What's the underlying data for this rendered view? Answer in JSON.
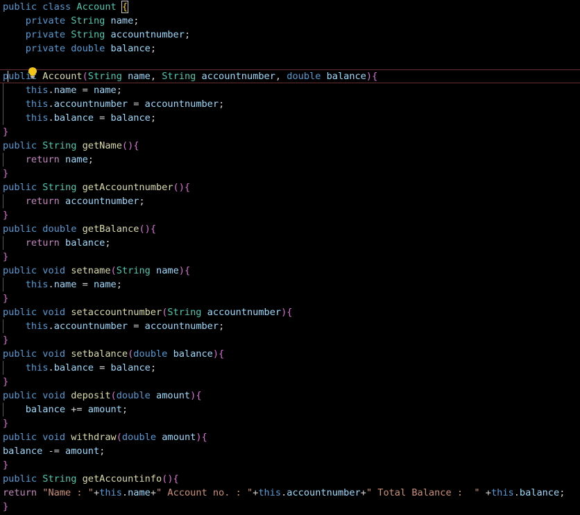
{
  "colors": {
    "background": "#000000",
    "keyword": "#569cd6",
    "type": "#4ec9b0",
    "method": "#dcdcaa",
    "variable": "#9cdcfe",
    "plain": "#d4d4d4",
    "string": "#ce9178",
    "control": "#c586c0",
    "bracket_gold": "#ffd700",
    "bracket_purple": "#da70d6",
    "bracket_blue": "#179fff"
  },
  "editor": {
    "icons": {
      "lightbulb": "lightbulb-icon"
    },
    "lines": [
      [
        [
          "public",
          "keyword"
        ],
        [
          " ",
          "plain"
        ],
        [
          "class",
          "keyword"
        ],
        [
          " ",
          "plain"
        ],
        [
          "Account",
          "type"
        ],
        [
          " ",
          "plain"
        ],
        [
          "{",
          "bracket_gold"
        ]
      ],
      [
        [
          "    ",
          "plain"
        ],
        [
          "private",
          "keyword"
        ],
        [
          " ",
          "plain"
        ],
        [
          "String",
          "type"
        ],
        [
          " ",
          "plain"
        ],
        [
          "name",
          "variable"
        ],
        [
          ";",
          "plain"
        ]
      ],
      [
        [
          "    ",
          "plain"
        ],
        [
          "private",
          "keyword"
        ],
        [
          " ",
          "plain"
        ],
        [
          "String",
          "type"
        ],
        [
          " ",
          "plain"
        ],
        [
          "accountnumber",
          "variable"
        ],
        [
          ";",
          "plain"
        ]
      ],
      [
        [
          "    ",
          "plain"
        ],
        [
          "private",
          "keyword"
        ],
        [
          " ",
          "plain"
        ],
        [
          "double",
          "keyword"
        ],
        [
          " ",
          "plain"
        ],
        [
          "balance",
          "variable"
        ],
        [
          ";",
          "plain"
        ]
      ],
      [],
      [
        [
          "public",
          "keyword"
        ],
        [
          " ",
          "plain"
        ],
        [
          "Account",
          "method"
        ],
        [
          "(",
          "bracket_purple"
        ],
        [
          "String",
          "type"
        ],
        [
          " ",
          "plain"
        ],
        [
          "name",
          "variable"
        ],
        [
          ", ",
          "plain"
        ],
        [
          "String",
          "type"
        ],
        [
          " ",
          "plain"
        ],
        [
          "accountnumber",
          "variable"
        ],
        [
          ", ",
          "plain"
        ],
        [
          "double",
          "keyword"
        ],
        [
          " ",
          "plain"
        ],
        [
          "balance",
          "variable"
        ],
        [
          ")",
          "bracket_purple"
        ],
        [
          "{",
          "bracket_purple"
        ]
      ],
      [
        [
          "    ",
          "plain"
        ],
        [
          "this",
          "keyword"
        ],
        [
          ".",
          "plain"
        ],
        [
          "name",
          "variable"
        ],
        [
          " = ",
          "plain"
        ],
        [
          "name",
          "variable"
        ],
        [
          ";",
          "plain"
        ]
      ],
      [
        [
          "    ",
          "plain"
        ],
        [
          "this",
          "keyword"
        ],
        [
          ".",
          "plain"
        ],
        [
          "accountnumber",
          "variable"
        ],
        [
          " = ",
          "plain"
        ],
        [
          "accountnumber",
          "variable"
        ],
        [
          ";",
          "plain"
        ]
      ],
      [
        [
          "    ",
          "plain"
        ],
        [
          "this",
          "keyword"
        ],
        [
          ".",
          "plain"
        ],
        [
          "balance",
          "variable"
        ],
        [
          " = ",
          "plain"
        ],
        [
          "balance",
          "variable"
        ],
        [
          ";",
          "plain"
        ]
      ],
      [
        [
          "}",
          "bracket_purple"
        ]
      ],
      [
        [
          "public",
          "keyword"
        ],
        [
          " ",
          "plain"
        ],
        [
          "String",
          "type"
        ],
        [
          " ",
          "plain"
        ],
        [
          "getName",
          "method"
        ],
        [
          "()",
          "bracket_purple"
        ],
        [
          "{",
          "bracket_purple"
        ]
      ],
      [
        [
          "    ",
          "plain"
        ],
        [
          "return",
          "control"
        ],
        [
          " ",
          "plain"
        ],
        [
          "name",
          "variable"
        ],
        [
          ";",
          "plain"
        ]
      ],
      [
        [
          "}",
          "bracket_purple"
        ]
      ],
      [
        [
          "public",
          "keyword"
        ],
        [
          " ",
          "plain"
        ],
        [
          "String",
          "type"
        ],
        [
          " ",
          "plain"
        ],
        [
          "getAccountnumber",
          "method"
        ],
        [
          "()",
          "bracket_purple"
        ],
        [
          "{",
          "bracket_purple"
        ]
      ],
      [
        [
          "    ",
          "plain"
        ],
        [
          "return",
          "control"
        ],
        [
          " ",
          "plain"
        ],
        [
          "accountnumber",
          "variable"
        ],
        [
          ";",
          "plain"
        ]
      ],
      [
        [
          "}",
          "bracket_purple"
        ]
      ],
      [
        [
          "public",
          "keyword"
        ],
        [
          " ",
          "plain"
        ],
        [
          "double",
          "keyword"
        ],
        [
          " ",
          "plain"
        ],
        [
          "getBalance",
          "method"
        ],
        [
          "()",
          "bracket_purple"
        ],
        [
          "{",
          "bracket_purple"
        ]
      ],
      [
        [
          "    ",
          "plain"
        ],
        [
          "return",
          "control"
        ],
        [
          " ",
          "plain"
        ],
        [
          "balance",
          "variable"
        ],
        [
          ";",
          "plain"
        ]
      ],
      [
        [
          "}",
          "bracket_purple"
        ]
      ],
      [
        [
          "public",
          "keyword"
        ],
        [
          " ",
          "plain"
        ],
        [
          "void",
          "keyword"
        ],
        [
          " ",
          "plain"
        ],
        [
          "setname",
          "method"
        ],
        [
          "(",
          "bracket_purple"
        ],
        [
          "String",
          "type"
        ],
        [
          " ",
          "plain"
        ],
        [
          "name",
          "variable"
        ],
        [
          ")",
          "bracket_purple"
        ],
        [
          "{",
          "bracket_purple"
        ]
      ],
      [
        [
          "    ",
          "plain"
        ],
        [
          "this",
          "keyword"
        ],
        [
          ".",
          "plain"
        ],
        [
          "name",
          "variable"
        ],
        [
          " = ",
          "plain"
        ],
        [
          "name",
          "variable"
        ],
        [
          ";",
          "plain"
        ]
      ],
      [
        [
          "}",
          "bracket_purple"
        ]
      ],
      [
        [
          "public",
          "keyword"
        ],
        [
          " ",
          "plain"
        ],
        [
          "void",
          "keyword"
        ],
        [
          " ",
          "plain"
        ],
        [
          "setaccountnumber",
          "method"
        ],
        [
          "(",
          "bracket_purple"
        ],
        [
          "String",
          "type"
        ],
        [
          " ",
          "plain"
        ],
        [
          "accountnumber",
          "variable"
        ],
        [
          ")",
          "bracket_purple"
        ],
        [
          "{",
          "bracket_purple"
        ]
      ],
      [
        [
          "    ",
          "plain"
        ],
        [
          "this",
          "keyword"
        ],
        [
          ".",
          "plain"
        ],
        [
          "accountnumber",
          "variable"
        ],
        [
          " = ",
          "plain"
        ],
        [
          "accountnumber",
          "variable"
        ],
        [
          ";",
          "plain"
        ]
      ],
      [
        [
          "}",
          "bracket_purple"
        ]
      ],
      [
        [
          "public",
          "keyword"
        ],
        [
          " ",
          "plain"
        ],
        [
          "void",
          "keyword"
        ],
        [
          " ",
          "plain"
        ],
        [
          "setbalance",
          "method"
        ],
        [
          "(",
          "bracket_purple"
        ],
        [
          "double",
          "keyword"
        ],
        [
          " ",
          "plain"
        ],
        [
          "balance",
          "variable"
        ],
        [
          ")",
          "bracket_purple"
        ],
        [
          "{",
          "bracket_purple"
        ]
      ],
      [
        [
          "    ",
          "plain"
        ],
        [
          "this",
          "keyword"
        ],
        [
          ".",
          "plain"
        ],
        [
          "balance",
          "variable"
        ],
        [
          " = ",
          "plain"
        ],
        [
          "balance",
          "variable"
        ],
        [
          ";",
          "plain"
        ]
      ],
      [
        [
          "}",
          "bracket_purple"
        ]
      ],
      [
        [
          "public",
          "keyword"
        ],
        [
          " ",
          "plain"
        ],
        [
          "void",
          "keyword"
        ],
        [
          " ",
          "plain"
        ],
        [
          "deposit",
          "method"
        ],
        [
          "(",
          "bracket_purple"
        ],
        [
          "double",
          "keyword"
        ],
        [
          " ",
          "plain"
        ],
        [
          "amount",
          "variable"
        ],
        [
          ")",
          "bracket_purple"
        ],
        [
          "{",
          "bracket_purple"
        ]
      ],
      [
        [
          "    ",
          "plain"
        ],
        [
          "balance",
          "variable"
        ],
        [
          " += ",
          "plain"
        ],
        [
          "amount",
          "variable"
        ],
        [
          ";",
          "plain"
        ]
      ],
      [
        [
          "}",
          "bracket_purple"
        ]
      ],
      [
        [
          "public",
          "keyword"
        ],
        [
          " ",
          "plain"
        ],
        [
          "void",
          "keyword"
        ],
        [
          " ",
          "plain"
        ],
        [
          "withdraw",
          "method"
        ],
        [
          "(",
          "bracket_purple"
        ],
        [
          "double",
          "keyword"
        ],
        [
          " ",
          "plain"
        ],
        [
          "amount",
          "variable"
        ],
        [
          ")",
          "bracket_purple"
        ],
        [
          "{",
          "bracket_purple"
        ]
      ],
      [
        [
          "balance",
          "variable"
        ],
        [
          " -= ",
          "plain"
        ],
        [
          "amount",
          "variable"
        ],
        [
          ";",
          "plain"
        ]
      ],
      [
        [
          "}",
          "bracket_purple"
        ]
      ],
      [
        [
          "public",
          "keyword"
        ],
        [
          " ",
          "plain"
        ],
        [
          "String",
          "type"
        ],
        [
          " ",
          "plain"
        ],
        [
          "getAccountinfo",
          "method"
        ],
        [
          "()",
          "bracket_purple"
        ],
        [
          "{",
          "bracket_purple"
        ]
      ],
      [
        [
          "return",
          "control"
        ],
        [
          " ",
          "plain"
        ],
        [
          "\"Name : \"",
          "string"
        ],
        [
          "+",
          "plain"
        ],
        [
          "this",
          "keyword"
        ],
        [
          ".",
          "plain"
        ],
        [
          "name",
          "variable"
        ],
        [
          "+",
          "plain"
        ],
        [
          "\" Account no. : \"",
          "string"
        ],
        [
          "+",
          "plain"
        ],
        [
          "this",
          "keyword"
        ],
        [
          ".",
          "plain"
        ],
        [
          "accountnumber",
          "variable"
        ],
        [
          "+",
          "plain"
        ],
        [
          "\" Total Balance :  \"",
          "string"
        ],
        [
          " +",
          "plain"
        ],
        [
          "this",
          "keyword"
        ],
        [
          ".",
          "plain"
        ],
        [
          "balance",
          "variable"
        ],
        [
          ";",
          "plain"
        ]
      ],
      [
        [
          "}",
          "bracket_purple"
        ]
      ]
    ]
  }
}
